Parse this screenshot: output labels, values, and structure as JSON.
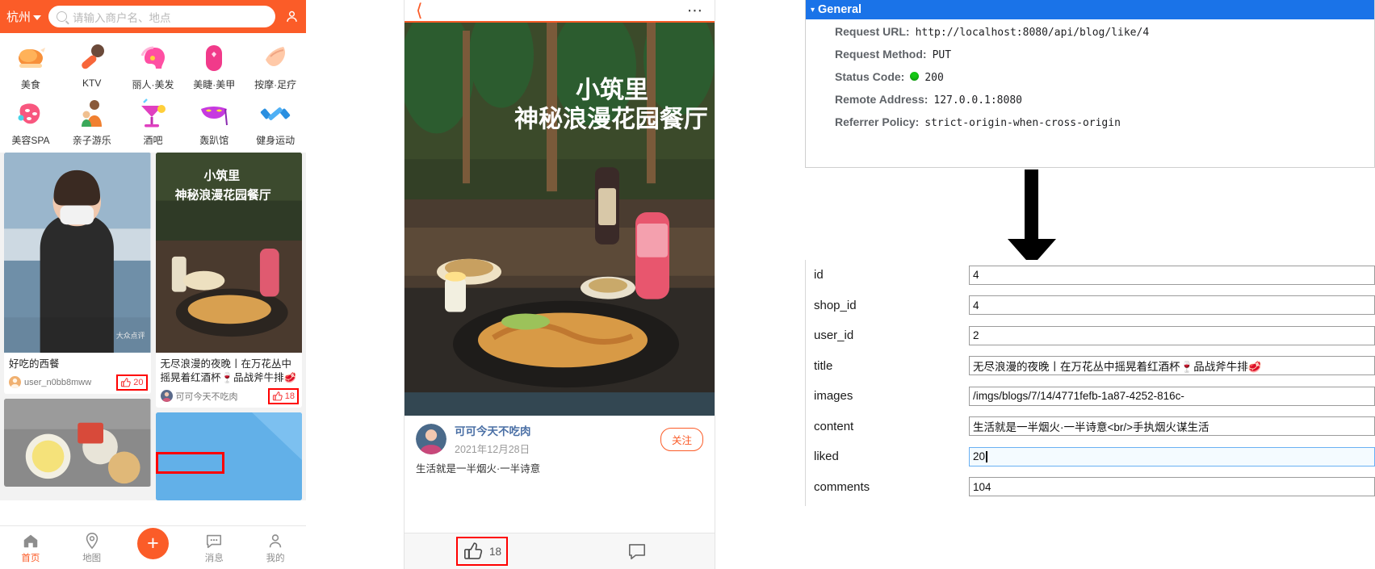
{
  "left_app": {
    "header": {
      "city": "杭州",
      "search_placeholder": "请输入商户名、地点",
      "profile_icon": "person-icon",
      "caret_icon": "chevron-down-icon"
    },
    "categories": [
      {
        "label": "美食",
        "icon": "roast-chicken-icon"
      },
      {
        "label": "KTV",
        "icon": "microphone-icon"
      },
      {
        "label": "丽人·美发",
        "icon": "hairstyle-icon"
      },
      {
        "label": "美睫·美甲",
        "icon": "nail-polish-icon"
      },
      {
        "label": "按摩·足疗",
        "icon": "massage-hand-icon"
      },
      {
        "label": "美容SPA",
        "icon": "face-mask-icon"
      },
      {
        "label": "亲子游乐",
        "icon": "parent-child-icon"
      },
      {
        "label": "酒吧",
        "icon": "cocktail-icon"
      },
      {
        "label": "轰趴馆",
        "icon": "party-mask-icon"
      },
      {
        "label": "健身运动",
        "icon": "dumbbell-icon"
      }
    ],
    "posts_left": [
      {
        "title": "好吃的西餐",
        "user": "user_n0bb8mww",
        "likes": "20",
        "likes_highlighted": true
      }
    ],
    "posts_right": [
      {
        "title": "无尽浪漫的夜晚丨在万花丛中摇晃着红酒杯🍷品战斧牛排🥩",
        "user": "可可今天不吃肉",
        "likes": "18",
        "likes_highlighted": true
      }
    ],
    "tabbar": [
      {
        "label": "首页",
        "icon": "home-icon",
        "active": true
      },
      {
        "label": "地图",
        "icon": "map-pin-icon",
        "active": false
      },
      {
        "label": "",
        "icon": "plus-icon",
        "active": false
      },
      {
        "label": "消息",
        "icon": "chat-bubble-icon",
        "active": false
      },
      {
        "label": "我的",
        "icon": "user-icon",
        "active": false
      }
    ]
  },
  "mid_app": {
    "back_icon": "back-chevron-icon",
    "more_icon": "more-dots-icon",
    "hero_caption_line1": "小筑里",
    "hero_caption_line2": "神秘浪漫花园餐厅",
    "author_name": "可可今天不吃肉",
    "author_date": "2021年12月28日",
    "follow_label": "关注",
    "blog_text": "生活就是一半烟火·一半诗意",
    "like_count": "18",
    "like_icon": "thumbs-up-icon",
    "comment_icon": "comment-icon",
    "like_highlighted": true
  },
  "devtools": {
    "section_title": "General",
    "caret": "▾",
    "rows": [
      {
        "key": "Request URL:",
        "value": "http://localhost:8080/api/blog/like/4",
        "dot": false
      },
      {
        "key": "Request Method:",
        "value": "PUT",
        "dot": false
      },
      {
        "key": "Status Code:",
        "value": "200",
        "dot": true
      },
      {
        "key": "Remote Address:",
        "value": "127.0.0.1:8080",
        "dot": false
      },
      {
        "key": "Referrer Policy:",
        "value": "strict-origin-when-cross-origin",
        "dot": false
      }
    ]
  },
  "db_form": {
    "fields": [
      {
        "label": "id",
        "value": "4",
        "focused": false
      },
      {
        "label": "shop_id",
        "value": "4",
        "focused": false
      },
      {
        "label": "user_id",
        "value": "2",
        "focused": false
      },
      {
        "label": "title",
        "value": "无尽浪漫的夜晚丨在万花丛中摇晃着红酒杯🍷品战斧牛排🥩",
        "focused": false
      },
      {
        "label": "images",
        "value": "/imgs/blogs/7/14/4771fefb-1a87-4252-816c-",
        "focused": false
      },
      {
        "label": "content",
        "value": "生活就是一半烟火·一半诗意<br/>手执烟火谋生活",
        "focused": false
      },
      {
        "label": "liked",
        "value": "20",
        "focused": true
      },
      {
        "label": "comments",
        "value": "104",
        "focused": false
      }
    ]
  },
  "colors": {
    "brand_orange": "#fb5c28",
    "devtools_blue": "#1a73e8",
    "highlight_red": "#ff0000",
    "status_green": "#14c914"
  }
}
